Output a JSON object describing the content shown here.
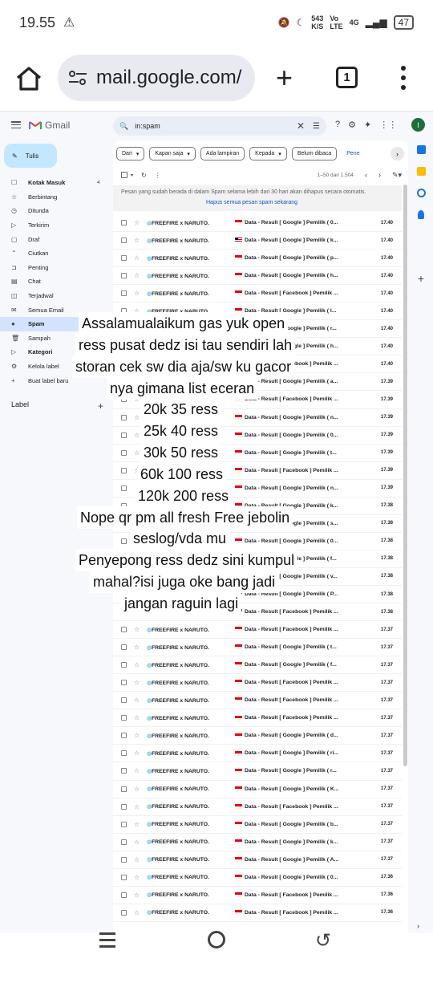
{
  "status": {
    "time": "19.55",
    "speed_top": "543",
    "speed_bot": "K/S",
    "lte_top": "Vo",
    "lte_bot": "LTE",
    "net": "4G",
    "battery": "47"
  },
  "browser": {
    "url": "mail.google.com/",
    "tab_count": "1"
  },
  "gmail": {
    "logo": "Gmail",
    "search_query": "in:spam",
    "avatar": "I",
    "compose": "Tulis",
    "nav": [
      {
        "icon": "☐",
        "label": "Kotak Masuk",
        "count": "4",
        "bold": true
      },
      {
        "icon": "☆",
        "label": "Berbintang"
      },
      {
        "icon": "◷",
        "label": "Ditunda"
      },
      {
        "icon": "▷",
        "label": "Terkirim"
      },
      {
        "icon": "▢",
        "label": "Draf"
      },
      {
        "icon": "⌃",
        "label": "Ciutkan"
      },
      {
        "icon": "⊐",
        "label": "Penting"
      },
      {
        "icon": "▤",
        "label": "Chat"
      },
      {
        "icon": "◫",
        "label": "Terjadwal"
      },
      {
        "icon": "✉",
        "label": "Semua Email"
      },
      {
        "icon": "●",
        "label": "Spam",
        "active": true
      },
      {
        "icon": "🗑",
        "label": "Sampah"
      },
      {
        "icon": "▷",
        "label": "Kategori",
        "bold": true
      },
      {
        "icon": "⚙",
        "label": "Kelola label"
      },
      {
        "icon": "+",
        "label": "Buat label baru"
      }
    ],
    "labels_heading": "Label",
    "chips": [
      "Dari",
      "Kapan saja",
      "Ada lampiran",
      "Kepada",
      "Belum dibaca",
      "Pene"
    ],
    "pager": "1–50 dari 1.504",
    "notice_text": "Pesan yang sudah berada di dalam Spam selama lebih dari 30 hari akan dihapus secara otomatis.",
    "notice_link": "Hapus semua pesan spam sekarang",
    "rows": [
      {
        "sender": "FREEFIRE x NARUTO.",
        "subject": "Data - Result [ Google ] Pemilik ( 0...",
        "time": "17.40",
        "flag": "id"
      },
      {
        "sender": "FREEFIRE x NARUTO.",
        "subject": "Data - Result [ Google ] Pemilik ( k...",
        "time": "17.40",
        "flag": "my"
      },
      {
        "sender": "FREEFIRE x NARUTO.",
        "subject": "Data - Result [ Google ] Pemilik ( p...",
        "time": "17.40",
        "flag": "id"
      },
      {
        "sender": "FREEFIRE x NARUTO.",
        "subject": "Data - Result [ Google ] Pemilik ( h...",
        "time": "17.40",
        "flag": "id"
      },
      {
        "sender": "FREEFIRE x NARUTO.",
        "subject": "Data - Result [ Facebook ] Pemilik ...",
        "time": "17.40",
        "flag": "id"
      },
      {
        "sender": "FREEFIRE x NARUTO.",
        "subject": "Data - Result [ Google ] Pemilik ( l...",
        "time": "17.40",
        "flag": "id"
      },
      {
        "sender": "FREEFIRE x NARUTO.",
        "subject": "Data - Result [ Google ] Pemilik ( r...",
        "time": "17.40",
        "flag": "id"
      },
      {
        "sender": "FREEFIRE x NARUTO.",
        "subject": "Data - Result [ Google ] Pemilik ( h...",
        "time": "17.40",
        "flag": "id"
      },
      {
        "sender": "FREEFIRE x NARUTO.",
        "subject": "Data - Result [ Facebook ] Pemilik ...",
        "time": "17.40",
        "flag": "id"
      },
      {
        "sender": "FREEFIRE x NARUTO.",
        "subject": "Data - Result [ Google ] Pemilik ( a...",
        "time": "17.39",
        "flag": "id"
      },
      {
        "sender": "FREEFIRE x NARUTO.",
        "subject": "Data - Result [ Facebook ] Pemilik ...",
        "time": "17.39",
        "flag": "id"
      },
      {
        "sender": "FREEFIRE x NARUTO.",
        "subject": "Data - Result [ Google ] Pemilik ( n...",
        "time": "17.39",
        "flag": "id"
      },
      {
        "sender": "FREEFIRE x NARUTO.",
        "subject": "Data - Result [ Google ] Pemilik ( 0...",
        "time": "17.39",
        "flag": "id"
      },
      {
        "sender": "FREEFIRE x NARUTO.",
        "subject": "Data - Result [ Google ] Pemilik ( t...",
        "time": "17.39",
        "flag": "id"
      },
      {
        "sender": "FREEFIRE x NARUTO.",
        "subject": "Data - Result [ Facebook ] Pemilik ...",
        "time": "17.39",
        "flag": "id"
      },
      {
        "sender": "FREEFIRE x NARUTO.",
        "subject": "Data - Result [ Google ] Pemilik ( n...",
        "time": "17.39",
        "flag": "id"
      },
      {
        "sender": "FREEFIRE x NARUTO.",
        "subject": "Data - Result [ Google ] Pemilik ( k...",
        "time": "17.38",
        "flag": "id"
      },
      {
        "sender": "FREEFIRE x NARUTO.",
        "subject": "Data - Result [ Google ] Pemilik ( s...",
        "time": "17.38",
        "flag": "id"
      },
      {
        "sender": "FREEFIRE x NARUTO.",
        "subject": "Data - Result [ Google ] Pemilik ( 0...",
        "time": "17.38",
        "flag": "id"
      },
      {
        "sender": "FREEFIRE x NARUTO.",
        "subject": "Data - Result [ Google ] Pemilik ( f...",
        "time": "17.38",
        "flag": "id"
      },
      {
        "sender": "FREEFIRE x NARUTO.",
        "subject": "Data - Result [ Google ] Pemilik ( v...",
        "time": "17.38",
        "flag": "id"
      },
      {
        "sender": "FREEFIRE x NARUTO.",
        "subject": "Data - Result [ Google ] Pemilik ( P...",
        "time": "17.38",
        "flag": "id"
      },
      {
        "sender": "FREEFIRE x NARUTO.",
        "subject": "Data - Result [ Facebook ] Pemilik ...",
        "time": "17.38",
        "flag": "id"
      },
      {
        "sender": "FREEFIRE x NARUTO.",
        "subject": "Data - Result [ Facebook ] Pemilik ...",
        "time": "17.37",
        "flag": "id"
      },
      {
        "sender": "FREEFIRE x NARUTO.",
        "subject": "Data - Result [ Google ] Pemilik ( t...",
        "time": "17.37",
        "flag": "id"
      },
      {
        "sender": "FREEFIRE x NARUTO.",
        "subject": "Data - Result [ Google ] Pemilik ( f...",
        "time": "17.37",
        "flag": "id"
      },
      {
        "sender": "FREEFIRE x NARUTO.",
        "subject": "Data - Result [ Facebook ] Pemilik ...",
        "time": "17.37",
        "flag": "id"
      },
      {
        "sender": "FREEFIRE x NARUTO.",
        "subject": "Data - Result [ Facebook ] Pemilik ...",
        "time": "17.37",
        "flag": "id"
      },
      {
        "sender": "FREEFIRE x NARUTO.",
        "subject": "Data - Result [ Facebook ] Pemilik ...",
        "time": "17.37",
        "flag": "id"
      },
      {
        "sender": "FREEFIRE x NARUTO.",
        "subject": "Data - Result [ Google ] Pemilik ( d...",
        "time": "17.37",
        "flag": "id"
      },
      {
        "sender": "FREEFIRE x NARUTO.",
        "subject": "Data - Result [ Google ] Pemilik ( ri...",
        "time": "17.37",
        "flag": "id"
      },
      {
        "sender": "FREEFIRE x NARUTO.",
        "subject": "Data - Result [ Google ] Pemilik ( r...",
        "time": "17.37",
        "flag": "id"
      },
      {
        "sender": "FREEFIRE x NARUTO.",
        "subject": "Data - Result [ Google ] Pemilik ( K...",
        "time": "17.37",
        "flag": "id"
      },
      {
        "sender": "FREEFIRE x NARUTO.",
        "subject": "Data - Result [ Facebook ] Pemilik ...",
        "time": "17.37",
        "flag": "id"
      },
      {
        "sender": "FREEFIRE x NARUTO.",
        "subject": "Data - Result [ Google ] Pemilik ( b...",
        "time": "17.37",
        "flag": "id"
      },
      {
        "sender": "FREEFIRE x NARUTO.",
        "subject": "Data - Result [ Google ] Pemilik ( k...",
        "time": "17.37",
        "flag": "id"
      },
      {
        "sender": "FREEFIRE x NARUTO.",
        "subject": "Data - Result [ Google ] Pemilik ( A...",
        "time": "17.37",
        "flag": "id"
      },
      {
        "sender": "FREEFIRE x NARUTO.",
        "subject": "Data - Result [ Google ] Pemilik ( 0...",
        "time": "17.36",
        "flag": "id"
      },
      {
        "sender": "FREEFIRE x NARUTO.",
        "subject": "Data - Result [ Facebook ] Pemilik ...",
        "time": "17.36",
        "flag": "id"
      },
      {
        "sender": "FREEFIRE x NARUTO.",
        "subject": "Data - Result [ Facebook ] Pemilik ...",
        "time": "17.36",
        "flag": "id"
      }
    ]
  },
  "overlay_text": [
    "Assalamualaikum gas yuk open",
    "ress pusat dedz isi tau sendiri lah",
    "storan cek sw dia aja/sw ku gacor",
    "nya gimana list eceran",
    "20k 35 ress",
    "25k 40 ress",
    "30k 50 ress",
    "60k 100 ress",
    "120k 200 ress",
    "Nope qr pm all fresh Free jebolin",
    "seslog/vda mu",
    "Penyepong ress dedz sini kumpul",
    "mahal?isi juga oke bang jadi",
    "jangan raguin lagi"
  ]
}
